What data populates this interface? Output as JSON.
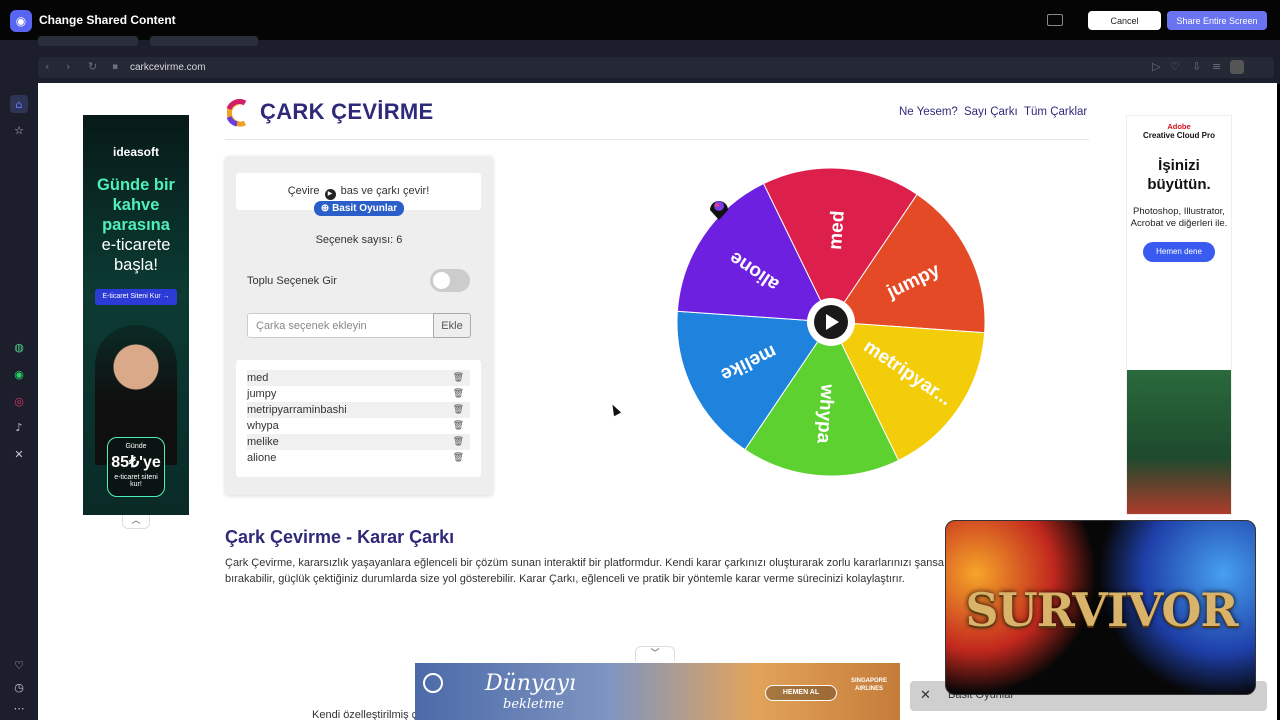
{
  "share": {
    "title": "Change Shared Content",
    "cancel_label": "Cancel",
    "share_label": "Share Entire Screen"
  },
  "browser": {
    "url": "carkcevirme.com"
  },
  "site": {
    "title": "ÇARK ÇEVİRME",
    "nav": [
      "Ne Yesem?",
      "Sayı Çarkı",
      "Tüm Çarklar"
    ]
  },
  "panel": {
    "instruction_before": "Çevire",
    "instruction_after": "bas ve çarkı çevir!",
    "games_badge": "⊕ Basit Oyunlar",
    "option_count": "Seçenek sayısı: 6",
    "bulk_label": "Toplu Seçenek Gir",
    "input_placeholder": "Çarka seçenek ekleyin",
    "add_label": "Ekle",
    "options": [
      "med",
      "jumpy",
      "metripyarraminbashi",
      "whypa",
      "melike",
      "alione"
    ]
  },
  "wheel": {
    "labels": [
      "med",
      "jumpy",
      "metripyar...",
      "whypa",
      "melike",
      "alione"
    ],
    "colors": [
      "#dc1f4b",
      "#e54a26",
      "#f3cd0a",
      "#5cd12f",
      "#1f83dd",
      "#6e20e0"
    ]
  },
  "article": {
    "title": "Çark Çevirme - Karar Çarkı",
    "text": "Çark Çevirme, kararsızlık yaşayanlara eğlenceli bir çözüm sunan interaktif bir platformdur. Kendi karar çarkınızı oluşturarak zorlu kararlarınızı şansa bırakabilir, güçlük çektiğiniz durumlarda size yol gösterebilir. Karar Çarkı, eğlenceli ve pratik bir yöntemle karar verme sürecinizi kolaylaştırır.",
    "more": "Kendi özelleştirilmiş çarkınızı oluşturarak karar verme sürecinde eğlenceli anlar yaşayabilirsiniz."
  },
  "ads": {
    "left": {
      "brand": "ideasoft",
      "headline": "Günde bir kahve parasına",
      "headline2": "e-ticarete başla!",
      "cta": "E-ticaret Siteni Kur →",
      "bubble_top": "Günde",
      "price": "85₺'ye",
      "bubble_bottom": "e-ticaret siteni kur!"
    },
    "right": {
      "brand": "Adobe",
      "product": "Creative Cloud Pro",
      "headline": "İşinizi büyütün.",
      "apps": "Photoshop, Illustrator, Acrobat ve diğerleri ile.",
      "cta": "Hemen dene"
    },
    "bottom": {
      "headline": "Dünyayı",
      "subline": "bekletme",
      "cta": "HEMEN AL",
      "airline": "SINGAPORE AIRLINES"
    }
  },
  "pip": {
    "label": "Basit Oyunlar",
    "video_title": "SURVIVOR"
  }
}
